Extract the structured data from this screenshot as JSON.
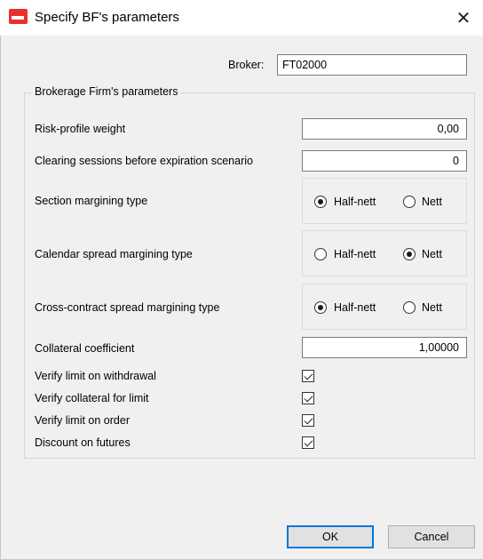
{
  "window": {
    "title": "Specify BF's parameters",
    "close_glyph": "✕"
  },
  "broker": {
    "label": "Broker:",
    "value": "FT02000"
  },
  "group": {
    "title": "Brokerage Firm's parameters",
    "risk_profile": {
      "label": "Risk-profile weight",
      "value": "0,00"
    },
    "clearing_sessions": {
      "label": "Clearing sessions before expiration scenario",
      "value": "0"
    },
    "section_margining": {
      "label": "Section margining type",
      "opt1": "Half-nett",
      "opt2": "Nett",
      "selected": "Half-nett"
    },
    "calendar_margining": {
      "label": "Calendar spread margining type",
      "opt1": "Half-nett",
      "opt2": "Nett",
      "selected": "Nett"
    },
    "cross_margining": {
      "label": "Cross-contract spread margining type",
      "opt1": "Half-nett",
      "opt2": "Nett",
      "selected": "Half-nett"
    },
    "collateral_coef": {
      "label": "Collateral coefficient",
      "value": "1,00000"
    },
    "checks": [
      {
        "label": "Verify limit on withdrawal",
        "checked": true
      },
      {
        "label": "Verify collateral for limit",
        "checked": true
      },
      {
        "label": "Verify limit on order",
        "checked": true
      },
      {
        "label": "Discount on futures",
        "checked": true
      }
    ]
  },
  "buttons": {
    "ok": "OK",
    "cancel": "Cancel"
  },
  "colors": {
    "accent": "#0078d7",
    "app_icon": "#e8312d"
  }
}
